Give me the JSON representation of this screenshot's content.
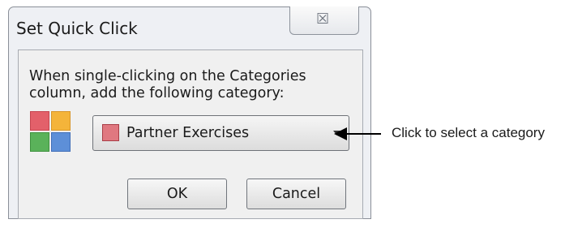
{
  "dialog": {
    "title": "Set Quick Click",
    "close_glyph": "☒",
    "instruction": "When single-clicking on the Categories column, add the following category:",
    "category_icon": "categories-icon",
    "category_select": {
      "selected": "Partner Exercises",
      "swatch_color": "#e07880"
    },
    "ok_label": "OK",
    "cancel_label": "Cancel"
  },
  "callout": {
    "text": "Click to select a category"
  }
}
